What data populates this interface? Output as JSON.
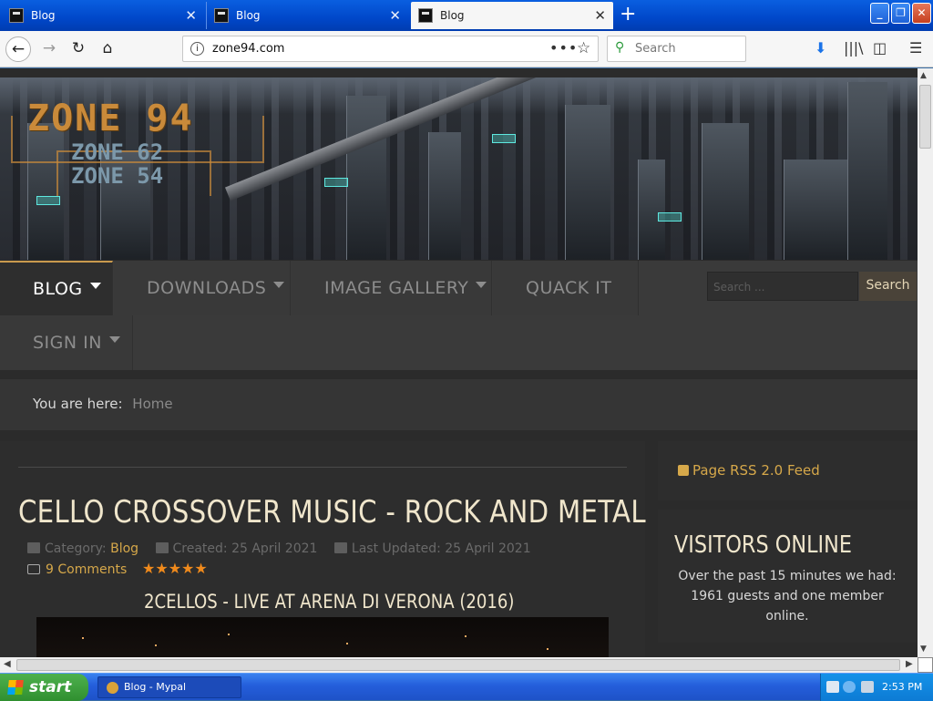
{
  "browser": {
    "tabs": [
      {
        "label": "Blog"
      },
      {
        "label": "Blog"
      },
      {
        "label": "Blog"
      }
    ],
    "url": "zone94.com",
    "search_placeholder": "Search"
  },
  "site": {
    "logo": {
      "line1": "ZONE 94",
      "line2": "ZONE 62",
      "line3": "ZONE 54"
    },
    "menu": {
      "blog": "BLOG",
      "downloads": "DOWNLOADS",
      "gallery": "IMAGE GALLERY",
      "quack": "QUACK IT",
      "signin": "SIGN IN"
    },
    "search_placeholder": "Search ...",
    "search_button": "Search",
    "breadcrumb": {
      "prefix": "You are here:",
      "current": "Home"
    }
  },
  "article": {
    "title": "CELLO CROSSOVER MUSIC - ROCK AND METAL",
    "category_label": "Category:",
    "category": "Blog",
    "created": "Created: 25 April 2021",
    "updated": "Last Updated: 25 April 2021",
    "comments": "9 Comments",
    "rating": 5,
    "rating_stars": "★★★★★",
    "subtitle": "2CELLOS - LIVE AT ARENA DI VERONA (2016)"
  },
  "sidebar": {
    "rss": "Page RSS 2.0 Feed",
    "visitors_title": "VISITORS ONLINE",
    "visitors_text": "Over the past 15 minutes we had: 1961 guests and one member online."
  },
  "taskbar": {
    "start": "start",
    "item": "Blog - Mypal",
    "time": "2:53 PM"
  },
  "colors": {
    "accent": "#d6a84a",
    "heading": "#f0e6cc",
    "menu_active": "#ffffff",
    "menu_inactive": "#8d8d8d"
  }
}
